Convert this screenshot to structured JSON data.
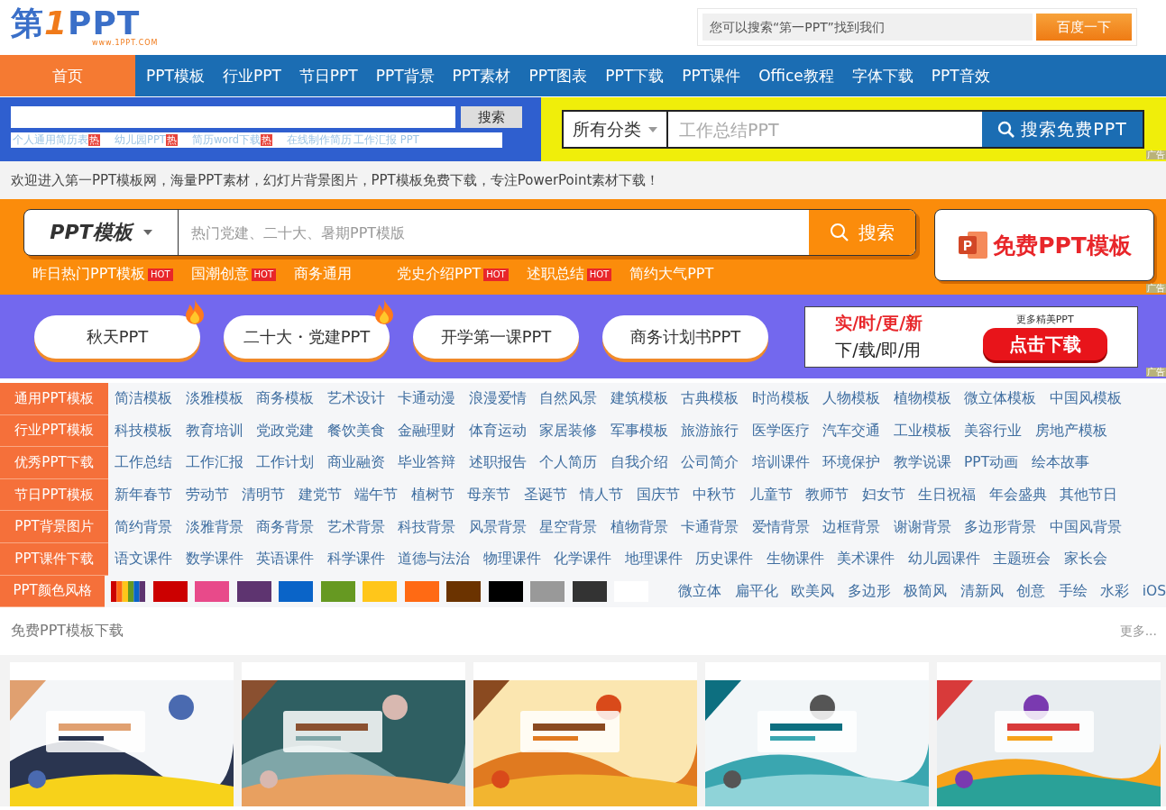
{
  "logo": {
    "parts": [
      "第",
      "1",
      "PPT"
    ],
    "url": "www.1PPT.COM"
  },
  "top_search": {
    "placeholder": "您可以搜索“第一PPT”找到我们",
    "button": "百度一下"
  },
  "nav": [
    {
      "label": "首页",
      "selected": true
    },
    {
      "label": "PPT模板",
      "selected": false
    },
    {
      "label": "行业PPT",
      "selected": false
    },
    {
      "label": "节日PPT",
      "selected": false
    },
    {
      "label": "PPT背景",
      "selected": false
    },
    {
      "label": "PPT素材",
      "selected": false
    },
    {
      "label": "PPT图表",
      "selected": false
    },
    {
      "label": "PPT下载",
      "selected": false
    },
    {
      "label": "PPT课件",
      "selected": false
    },
    {
      "label": "Office教程",
      "selected": false
    },
    {
      "label": "字体下载",
      "selected": false
    },
    {
      "label": "PPT音效",
      "selected": false
    }
  ],
  "resume_search": {
    "button": "搜索",
    "links": [
      {
        "label": "个人通用简历表",
        "badge": "热"
      },
      {
        "label": "幼儿园PPT",
        "badge": "热"
      },
      {
        "label": "简历word下载",
        "badge": "热"
      },
      {
        "label": "在线制作简历"
      },
      {
        "label": "工作汇报 PPT"
      }
    ]
  },
  "free_search": {
    "category": "所有分类",
    "placeholder": "工作总结PPT",
    "button": "搜索免费PPT",
    "ad_label": "广告"
  },
  "welcome": "欢迎进入第一PPT模板网，海量PPT素材，幻灯片背景图片，PPT模板免费下载，专注PowerPoint素材下载！",
  "template_search": {
    "category": "PPT模板",
    "placeholder": "热门党建、二十大、暑期PPT模版",
    "button": "搜索",
    "links": [
      {
        "label": "昨日热门PPT模板",
        "badge": "HOT"
      },
      {
        "label": "国潮创意",
        "badge": "HOT"
      },
      {
        "label": "商务通用"
      },
      {
        "label": "党史介绍PPT",
        "badge": "HOT"
      },
      {
        "label": "述职总结",
        "badge": "HOT"
      },
      {
        "label": "简约大气PPT"
      }
    ],
    "promo": "免费PPT模板",
    "ad_label": "广告"
  },
  "topic_band": {
    "pills": [
      {
        "label": "秋天PPT",
        "hot": true
      },
      {
        "label": "二十大・党建PPT",
        "hot": true
      },
      {
        "label": "开学第一课PPT",
        "hot": false
      },
      {
        "label": "商务计划书PPT",
        "hot": false
      }
    ],
    "promo_line1": "实/时/更/新",
    "promo_line2": "下/载/即/用",
    "promo_more": "更多精美PPT",
    "promo_button": "点击下载",
    "ad_label": "广告"
  },
  "categories": [
    {
      "kind": "links",
      "label": "通用PPT模板",
      "links": [
        "简洁模板",
        "淡雅模板",
        "商务模板",
        "艺术设计",
        "卡通动漫",
        "浪漫爱情",
        "自然风景",
        "建筑模板",
        "古典模板",
        "时尚模板",
        "人物模板",
        "植物模板",
        "微立体模板",
        "中国风模板"
      ]
    },
    {
      "kind": "links",
      "label": "行业PPT模板",
      "links": [
        "科技模板",
        "教育培训",
        "党政党建",
        "餐饮美食",
        "金融理财",
        "体育运动",
        "家居装修",
        "军事模板",
        "旅游旅行",
        "医学医疗",
        "汽车交通",
        "工业模板",
        "美容行业",
        "房地产模板"
      ]
    },
    {
      "kind": "links",
      "label": "优秀PPT下载",
      "links": [
        "工作总结",
        "工作汇报",
        "工作计划",
        "商业融资",
        "毕业答辩",
        "述职报告",
        "个人简历",
        "自我介绍",
        "公司简介",
        "培训课件",
        "环境保护",
        "教学说课",
        "PPT动画",
        "绘本故事"
      ]
    },
    {
      "kind": "links",
      "label": "节日PPT模板",
      "links": [
        "新年春节",
        "劳动节",
        "清明节",
        "建党节",
        "端午节",
        "植树节",
        "母亲节",
        "圣诞节",
        "情人节",
        "国庆节",
        "中秋节",
        "儿童节",
        "教师节",
        "妇女节",
        "生日祝福",
        "年会盛典",
        "其他节日"
      ]
    },
    {
      "kind": "links",
      "label": "PPT背景图片",
      "links": [
        "简约背景",
        "淡雅背景",
        "商务背景",
        "艺术背景",
        "科技背景",
        "风景背景",
        "星空背景",
        "植物背景",
        "卡通背景",
        "爱情背景",
        "边框背景",
        "谢谢背景",
        "多边形背景",
        "中国风背景"
      ]
    },
    {
      "kind": "links",
      "label": "PPT课件下载",
      "links": [
        "语文课件",
        "数学课件",
        "英语课件",
        "科学课件",
        "道德与法治",
        "物理课件",
        "化学课件",
        "地理课件",
        "历史课件",
        "生物课件",
        "美术课件",
        "幼儿园课件",
        "主题班会",
        "家长会"
      ]
    },
    {
      "kind": "colors",
      "label": "PPT颜色风格",
      "swatches": [
        {
          "kind": "rainbow"
        },
        {
          "kind": "solid",
          "color": "#cc0000"
        },
        {
          "kind": "solid",
          "color": "#e84a8a"
        },
        {
          "kind": "solid",
          "color": "#5e3470"
        },
        {
          "kind": "solid",
          "color": "#0a64c8"
        },
        {
          "kind": "solid",
          "color": "#669922"
        },
        {
          "kind": "solid",
          "color": "#ffc61a"
        },
        {
          "kind": "solid",
          "color": "#ff6a14"
        },
        {
          "kind": "solid",
          "color": "#6b3300"
        },
        {
          "kind": "solid",
          "color": "#000000"
        },
        {
          "kind": "solid",
          "color": "#999999"
        },
        {
          "kind": "solid",
          "color": "#333333"
        },
        {
          "kind": "solid",
          "color": "#ffffff"
        }
      ],
      "links": [
        "微立体",
        "扁平化",
        "欧美风",
        "多边形",
        "极简风",
        "清新风",
        "创意",
        "手绘",
        "水彩",
        "iOS"
      ]
    }
  ],
  "free_section": {
    "title": "免费PPT模板下载",
    "more": "更多..."
  }
}
